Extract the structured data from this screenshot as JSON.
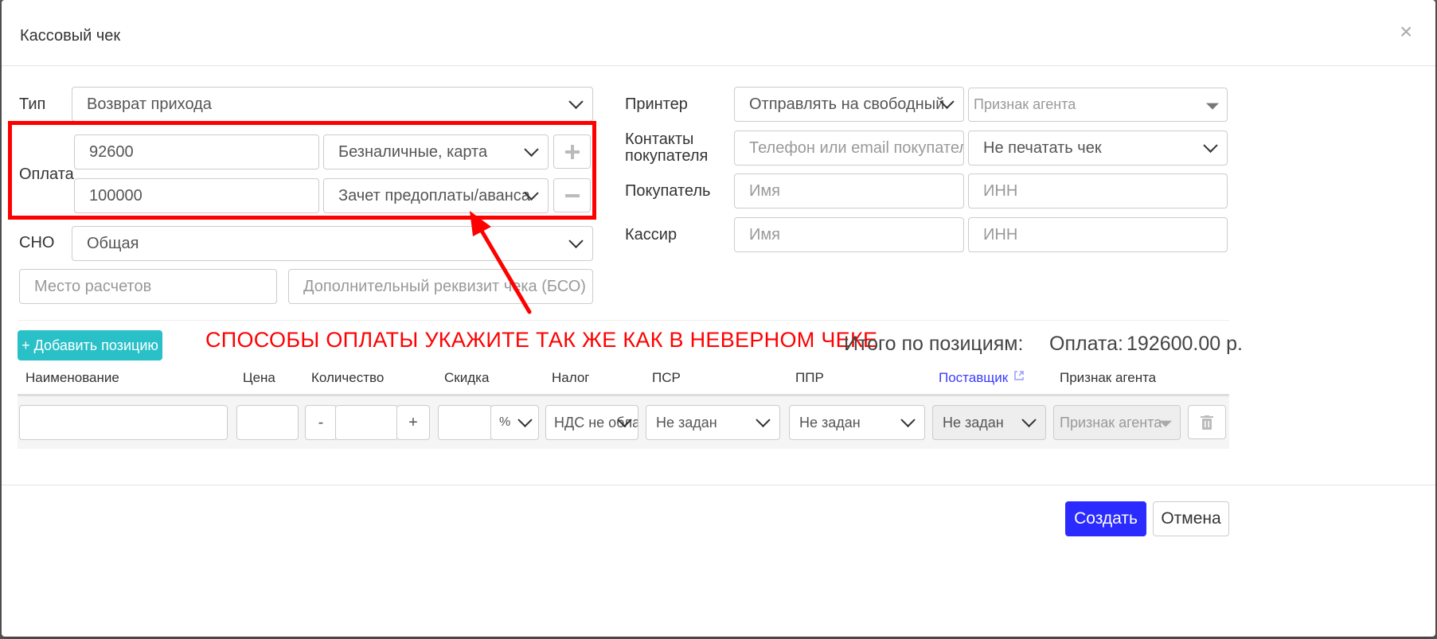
{
  "dialog": {
    "title": "Кассовый чек",
    "close_glyph": "×"
  },
  "form": {
    "type_label": "Тип",
    "type_value": "Возврат прихода",
    "payment_label": "Оплата",
    "payments": [
      {
        "amount": "92600",
        "method": "Безналичные, карта"
      },
      {
        "amount": "100000",
        "method": "Зачет предоплаты/аванса"
      }
    ],
    "sno_label": "СНО",
    "sno_value": "Общая",
    "place_placeholder": "Место расчетов",
    "extra_placeholder": "Дополнительный реквизит чека (БСО)",
    "printer_label": "Принтер",
    "printer_value": "Отправлять на свободный",
    "agent_placeholder": "Признак агента",
    "contacts_label": "Контакты покупателя",
    "contacts_placeholder": "Телефон или email покупателя",
    "print_value": "Не печатать чек",
    "buyer_label": "Покупатель",
    "buyer_name_placeholder": "Имя",
    "buyer_inn_placeholder": "ИНН",
    "cashier_label": "Кассир",
    "cashier_name_placeholder": "Имя",
    "cashier_inn_placeholder": "ИНН"
  },
  "annotation": {
    "text": "СПОСОБЫ ОПЛАТЫ УКАЖИТЕ ТАК ЖЕ КАК В НЕВЕРНОМ ЧЕКЕ",
    "color": "#ff0000"
  },
  "positions": {
    "add_button": "+ Добавить позицию",
    "totals_label": "Итого по позициям:",
    "payment_total_label": "Оплата:",
    "payment_total_value": "192600.00 р.",
    "columns": [
      "Наименование",
      "Цена",
      "Количество",
      "Скидка",
      "Налог",
      "ПСР",
      "ППР",
      "Поставщик",
      "Признак агента"
    ],
    "row": {
      "minus": "-",
      "plus": "+",
      "discount_unit": "%",
      "tax": "НДС не облагается",
      "psr": "Не задан",
      "ppr": "Не задан",
      "supplier": "Не задан",
      "agent": "Признак агента"
    }
  },
  "footer": {
    "create": "Создать",
    "cancel": "Отмена"
  },
  "colors": {
    "accent": "#2b2bff",
    "teal": "#29c0c8",
    "annotation": "#ff0000"
  }
}
